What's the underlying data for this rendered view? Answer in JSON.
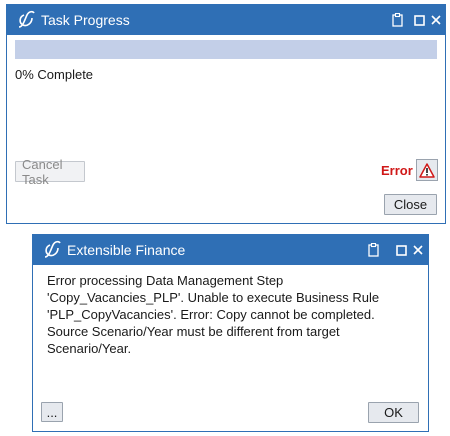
{
  "task_window": {
    "title": "Task Progress",
    "progress": {
      "percent": 0,
      "text": "0% Complete"
    },
    "cancel_label": "Cancel Task",
    "error_label": "Error",
    "close_label": "Close"
  },
  "finance_window": {
    "title": "Extensible Finance",
    "message": "Error processing Data Management Step 'Copy_Vacancies_PLP'. Unable to execute Business Rule 'PLP_CopyVacancies'. Error: Copy cannot be completed. Source Scenario/Year must be different from target Scenario/Year.",
    "more_label": "...",
    "ok_label": "OK"
  },
  "colors": {
    "titlebar": "#2f6fb5",
    "progress_track": "#c3cfe8",
    "error_text": "#d01818"
  },
  "icons": [
    "app-logo-icon",
    "clipboard-icon",
    "maximize-icon",
    "close-icon",
    "warning-icon"
  ]
}
